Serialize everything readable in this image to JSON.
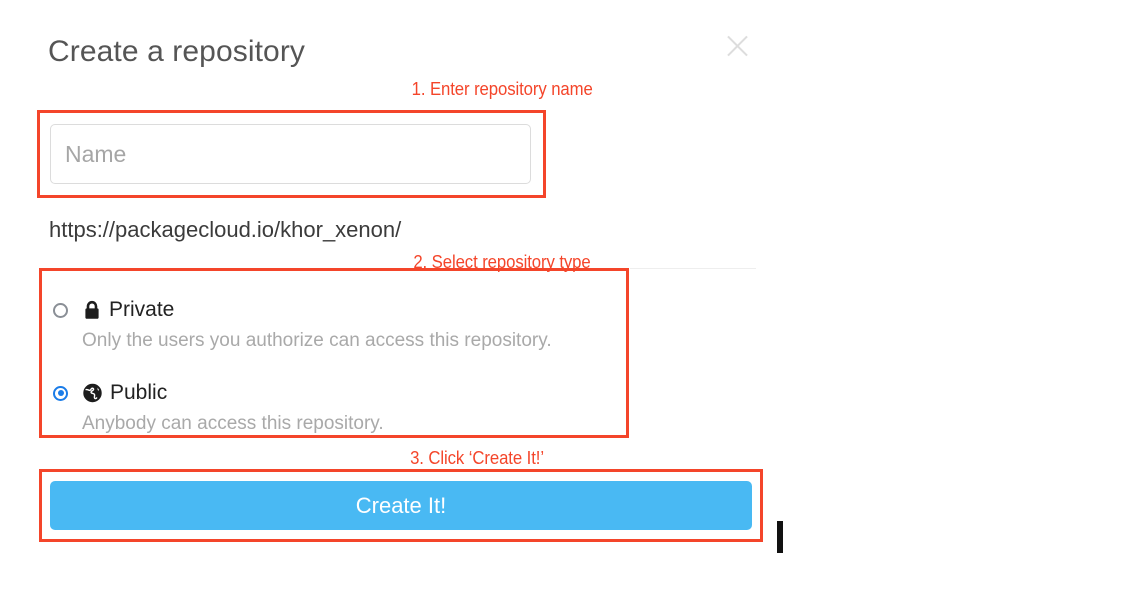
{
  "dialog": {
    "title": "Create a repository",
    "close_icon": "close-icon"
  },
  "annotations": [
    {
      "id": "step-1",
      "text": "1. Enter repository name",
      "color": "#f4452a"
    },
    {
      "id": "step-2",
      "text": "2. Select repository type",
      "color": "#f4452a"
    },
    {
      "id": "step-3",
      "text": "3. Click ‘Create It!’",
      "color": "#f4452a"
    }
  ],
  "form": {
    "name_field": {
      "label": "Name",
      "placeholder": "Name",
      "value": ""
    },
    "url_preview": "https://packagecloud.io/khor_xenon/",
    "repository_type": {
      "selected": "public",
      "options": [
        {
          "id": "private",
          "label": "Private",
          "icon": "lock-icon",
          "description": "Only the users you authorize can access this repository.",
          "selected": false
        },
        {
          "id": "public",
          "label": "Public",
          "icon": "globe-icon",
          "description": "Anybody can access this repository.",
          "selected": true
        }
      ]
    },
    "submit": {
      "label": "Create It!",
      "color": "#49b9f3"
    }
  },
  "colors": {
    "annotation_red": "#f4452a",
    "button_blue": "#49b9f3",
    "radio_blue": "#1a7ce8",
    "title_gray": "#555555",
    "muted_gray": "#a9a9a9"
  }
}
